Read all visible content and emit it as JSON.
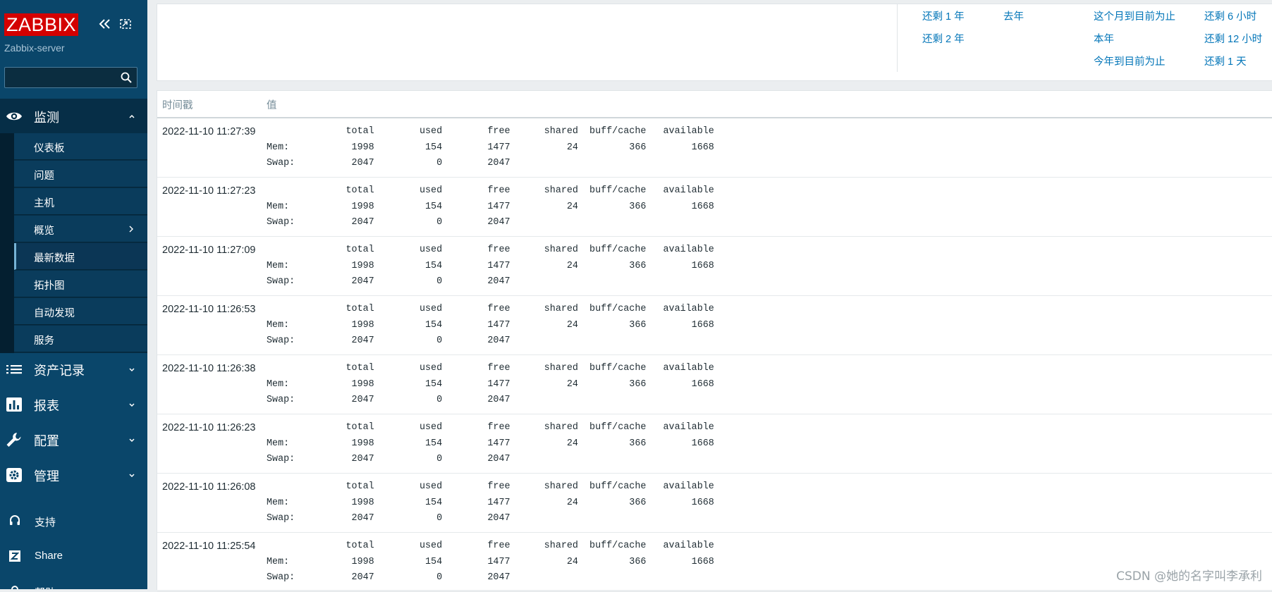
{
  "sidebar": {
    "logo": "ZABBIX",
    "server": "Zabbix-server",
    "search": {
      "value": "",
      "placeholder": ""
    },
    "groups": [
      {
        "label": "监测",
        "icon": "eye-icon",
        "expanded": true
      },
      {
        "label": "资产记录",
        "icon": "list-icon"
      },
      {
        "label": "报表",
        "icon": "bar-chart-icon"
      },
      {
        "label": "配置",
        "icon": "wrench-icon"
      },
      {
        "label": "管理",
        "icon": "gear-icon"
      }
    ],
    "monitoring_items": [
      {
        "label": "仪表板"
      },
      {
        "label": "问题"
      },
      {
        "label": "主机"
      },
      {
        "label": "概览",
        "has_submenu": true
      },
      {
        "label": "最新数据",
        "selected": true
      },
      {
        "label": "拓扑图"
      },
      {
        "label": "自动发现"
      },
      {
        "label": "服务"
      }
    ],
    "bottom": [
      {
        "label": "支持",
        "icon": "headset-icon"
      },
      {
        "label": "Share",
        "icon": "share-z-icon"
      },
      {
        "label": "帮助",
        "icon": "help-icon"
      }
    ]
  },
  "time_ranges": [
    [
      "还剩 1 年",
      "还剩 2 年"
    ],
    [
      "去年"
    ],
    [
      "这个月到目前为止",
      "本年",
      "今年到目前为止"
    ],
    [
      "还剩 6 小时",
      "还剩 12 小时",
      "还剩 1 天"
    ]
  ],
  "table": {
    "headers": [
      "时间戳",
      "值"
    ],
    "rows": [
      {
        "timestamp": "2022-11-10 11:27:39",
        "value": "              total        used        free      shared  buff/cache   available\nMem:           1998         154        1477          24         366        1668\nSwap:          2047           0        2047"
      },
      {
        "timestamp": "2022-11-10 11:27:23",
        "value": "              total        used        free      shared  buff/cache   available\nMem:           1998         154        1477          24         366        1668\nSwap:          2047           0        2047"
      },
      {
        "timestamp": "2022-11-10 11:27:09",
        "value": "              total        used        free      shared  buff/cache   available\nMem:           1998         154        1477          24         366        1668\nSwap:          2047           0        2047"
      },
      {
        "timestamp": "2022-11-10 11:26:53",
        "value": "              total        used        free      shared  buff/cache   available\nMem:           1998         154        1477          24         366        1668\nSwap:          2047           0        2047"
      },
      {
        "timestamp": "2022-11-10 11:26:38",
        "value": "              total        used        free      shared  buff/cache   available\nMem:           1998         154        1477          24         366        1668\nSwap:          2047           0        2047"
      },
      {
        "timestamp": "2022-11-10 11:26:23",
        "value": "              total        used        free      shared  buff/cache   available\nMem:           1998         154        1477          24         366        1668\nSwap:          2047           0        2047"
      },
      {
        "timestamp": "2022-11-10 11:26:08",
        "value": "              total        used        free      shared  buff/cache   available\nMem:           1998         154        1477          24         366        1668\nSwap:          2047           0        2047"
      },
      {
        "timestamp": "2022-11-10 11:25:54",
        "value": "              total        used        free      shared  buff/cache   available\nMem:           1998         154        1477          24         366        1668\nSwap:          2047           0        2047"
      }
    ]
  },
  "watermark": "CSDN @她的名字叫李承利",
  "colors": {
    "sidebar": "#0a466a",
    "logo": "#d40000",
    "link": "#0275b8"
  }
}
